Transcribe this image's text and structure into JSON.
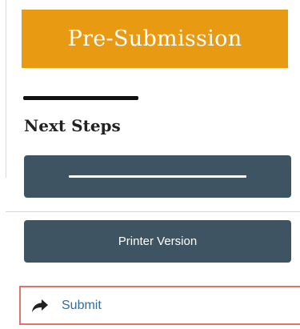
{
  "workflow": {
    "state_label": "Pre-Submission"
  },
  "next_steps": {
    "heading": "Next Steps",
    "printer_version_label": "Printer Version"
  },
  "activities": {
    "submit_label": "Submit"
  },
  "colors": {
    "state_banner": "#e99a13",
    "button": "#3f5462",
    "submit_border": "#e0736a",
    "link_text": "#2f6f9e"
  },
  "icons": {
    "submit": "share-arrow-icon"
  }
}
